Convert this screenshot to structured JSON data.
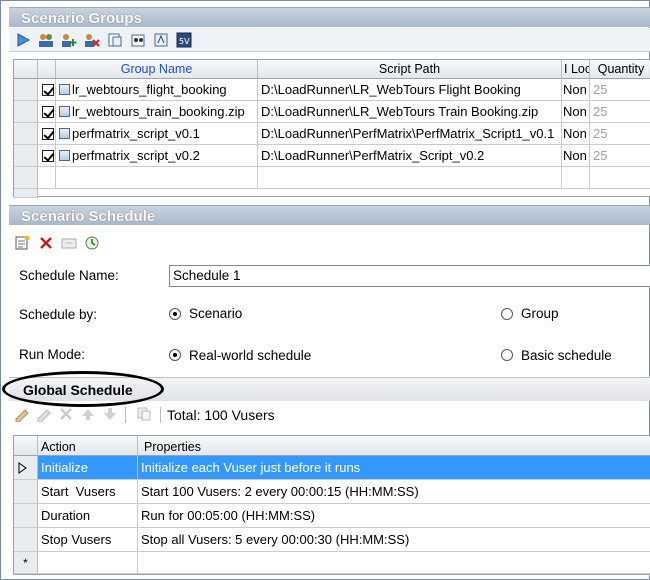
{
  "scenario_groups": {
    "title": "Scenario Groups",
    "toolbar_icons": [
      "play-icon",
      "vuser-group-icon",
      "add-group-icon",
      "remove-group-icon",
      "details-icon",
      "runtime-settings-icon",
      "script-icon",
      "vusers-icon"
    ],
    "columns": [
      "Group Name",
      "Script Path",
      "I Loc",
      "Quantity"
    ],
    "rows": [
      {
        "name": "lr_webtours_flight_booking",
        "path": "D:\\LoadRunner\\LR_WebTours Flight Booking",
        "loc": "Non",
        "qty": "25"
      },
      {
        "name": "lr_webtours_train_booking.zip",
        "path": "D:\\LoadRunner\\LR_WebTours Train Booking.zip",
        "loc": "Non",
        "qty": "25"
      },
      {
        "name": "perfmatrix_script_v0.1",
        "path": "D:\\LoadRunner\\PerfMatrix\\PerfMatrix_Script1_v0.1",
        "loc": "Non",
        "qty": "25"
      },
      {
        "name": "perfmatrix_script_v0.2",
        "path": "D:\\LoadRunner\\PerfMatrix_Script_v0.2",
        "loc": "Non",
        "qty": "25"
      }
    ]
  },
  "scenario_schedule": {
    "title": "Scenario Schedule",
    "toolbar_icons": [
      "new-schedule-icon",
      "delete-icon",
      "rename-icon",
      "schedule-settings-icon"
    ],
    "schedule_name_label": "Schedule Name:",
    "schedule_name_value": "Schedule 1",
    "schedule_by_label": "Schedule by:",
    "schedule_by_options": [
      "Scenario",
      "Group"
    ],
    "schedule_by_selected": "Scenario",
    "run_mode_label": "Run Mode:",
    "run_mode_options": [
      "Real-world schedule",
      "Basic schedule"
    ],
    "run_mode_selected": "Real-world schedule"
  },
  "global_schedule": {
    "title": "Global Schedule",
    "total": "Total: 100 Vusers",
    "columns": [
      "Action",
      "Properties"
    ],
    "rows": [
      {
        "action": "Initialize",
        "properties": "Initialize each Vuser just before it runs"
      },
      {
        "action": "Start  Vusers",
        "properties": "Start 100 Vusers: 2 every 00:00:15 (HH:MM:SS)"
      },
      {
        "action": "Duration",
        "properties": "Run for 00:05:00 (HH:MM:SS)"
      },
      {
        "action": "Stop Vusers",
        "properties": "Stop all Vusers: 5 every 00:00:30 (HH:MM:SS)"
      }
    ],
    "new_row_marker": "*"
  },
  "colors": {
    "accent": "#3399ff",
    "header": "#a9b8ca",
    "link_blue": "#1f4fd0"
  }
}
